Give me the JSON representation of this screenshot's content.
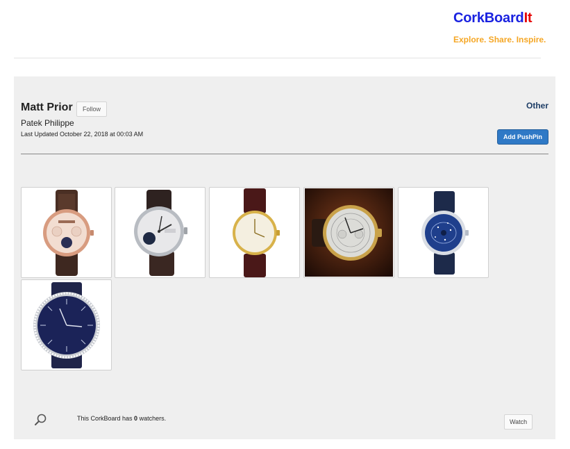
{
  "header": {
    "logo_part1": "CorkBoard",
    "logo_part2": "It",
    "tagline": "Explore. Share. Inspire."
  },
  "board": {
    "owner": "Matt Prior",
    "follow_label": "Follow",
    "category": "Other",
    "title": "Patek Philippe",
    "last_updated": "Last Updated October 22, 2018 at 00:03 AM",
    "add_pushpin_label": "Add PushPin"
  },
  "pushpins": [
    {
      "icon": "rose-gold-perpetual-calendar-watch"
    },
    {
      "icon": "white-gold-annual-calendar-watch"
    },
    {
      "icon": "yellow-gold-calatrava-watch"
    },
    {
      "icon": "gold-chronograph-watch"
    },
    {
      "icon": "blue-celestial-watch"
    },
    {
      "icon": "blue-diamond-bezel-watch"
    }
  ],
  "footer": {
    "watchers_prefix": "This CorkBoard has ",
    "watchers_count": "0",
    "watchers_suffix": " watchers.",
    "watch_label": "Watch"
  },
  "colors": {
    "logo_blue": "#1a22e0",
    "logo_red": "#e60000",
    "tagline_orange": "#f5a623",
    "button_blue": "#2f79c6",
    "category_navy": "#1d3d66"
  }
}
